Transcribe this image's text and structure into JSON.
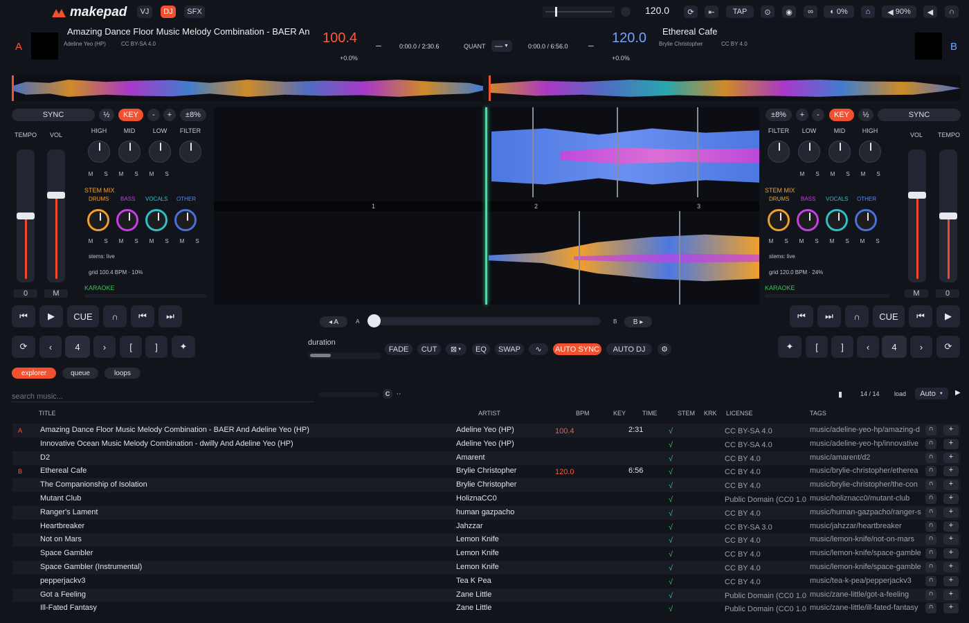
{
  "app": {
    "logo": "makepad",
    "modes": [
      "VJ",
      "DJ",
      "SFX"
    ],
    "active_mode": "DJ",
    "bpm": "120.0",
    "tap": "TAP",
    "crossfade_pct": "0%",
    "volume_pct": "90%"
  },
  "deckA": {
    "letter": "A",
    "title": "Amazing Dance Floor Music Melody Combination - BAER An",
    "artist": "Adeline Yeo (HP)",
    "license": "CC BY-SA 4.0",
    "bpm": "100.4",
    "pitch": "+0.0%",
    "time": "0:00.0 / 2:30.6",
    "sync": "SYNC",
    "half": "½",
    "key": "KEY",
    "minus": "-",
    "plus": "+",
    "range": "±8%",
    "tempo": "TEMPO",
    "vol": "VOL",
    "tempo_val": "0",
    "vol_val": "M",
    "eq": [
      "HIGH",
      "MID",
      "LOW",
      "FILTER"
    ],
    "stem_mix": "STEM MIX",
    "stems": [
      "DRUMS",
      "BASS",
      "VOCALS",
      "OTHER"
    ],
    "stems_status": "stems: live",
    "grid": "grid 100.4 BPM · 10%",
    "karaoke": "KARAOKE",
    "cue": "CUE",
    "loop_len": "4"
  },
  "deckB": {
    "letter": "B",
    "title": "Ethereal Cafe",
    "artist": "Brylie Christopher",
    "license": "CC BY 4.0",
    "bpm": "120.0",
    "pitch": "+0.0%",
    "time": "0:00.0 / 6:56.0",
    "sync": "SYNC",
    "half": "½",
    "key": "KEY",
    "minus": "-",
    "plus": "+",
    "range": "±8%",
    "tempo": "TEMPO",
    "vol": "VOL",
    "tempo_val": "0",
    "vol_val": "M",
    "eq": [
      "FILTER",
      "LOW",
      "MID",
      "HIGH"
    ],
    "stem_mix": "STEM MIX",
    "stems": [
      "DRUMS",
      "BASS",
      "VOCALS",
      "OTHER"
    ],
    "stems_status": "stems: live",
    "grid": "grid 120.0 BPM · 24%",
    "karaoke": "KARAOKE",
    "cue": "CUE",
    "loop_len": "4"
  },
  "center": {
    "quant": "QUANT",
    "quant_val": "—",
    "beats": [
      "1",
      "2",
      "3"
    ],
    "xfade_a": "◂ A",
    "xfade_a_lbl": "A",
    "xfade_b": "B ▸",
    "xfade_b_lbl": "B",
    "duration": "duration",
    "fx": [
      "FADE",
      "CUT",
      "EQ",
      "SWAP",
      "AUTO SYNC",
      "AUTO DJ"
    ]
  },
  "library": {
    "tabs": [
      "explorer",
      "queue",
      "loops"
    ],
    "active_tab": "explorer",
    "search_placeholder": "search music...",
    "count": "14 / 14",
    "load": "load",
    "mode": "Auto",
    "columns": [
      "TITLE",
      "ARTIST",
      "BPM",
      "KEY",
      "TIME",
      "STEM",
      "KRK",
      "LICENSE",
      "TAGS"
    ],
    "rows": [
      {
        "deck": "A",
        "title": "Amazing Dance Floor Music Melody Combination - BAER And Adeline Yeo (HP)",
        "artist": "Adeline Yeo (HP)",
        "bpm": "100.4",
        "time": "2:31",
        "stem": "√",
        "license": "CC BY-SA 4.0",
        "tags": "music/adeline-yeo-hp/amazing-d"
      },
      {
        "deck": "",
        "title": "Innovative Ocean Music Melody Combination - dwilly And Adeline Yeo (HP)",
        "artist": "Adeline Yeo (HP)",
        "bpm": "",
        "time": "",
        "stem": "√",
        "license": "CC BY-SA 4.0",
        "tags": "music/adeline-yeo-hp/innovative"
      },
      {
        "deck": "",
        "title": "D2",
        "artist": "Amarent",
        "bpm": "",
        "time": "",
        "stem": "√",
        "license": "CC BY 4.0",
        "tags": "music/amarent/d2"
      },
      {
        "deck": "B",
        "title": "Ethereal Cafe",
        "artist": "Brylie Christopher",
        "bpm": "120.0",
        "time": "6:56",
        "stem": "√",
        "license": "CC BY 4.0",
        "tags": "music/brylie-christopher/etherea"
      },
      {
        "deck": "",
        "title": "The Companionship of Isolation",
        "artist": "Brylie Christopher",
        "bpm": "",
        "time": "",
        "stem": "√",
        "license": "CC BY 4.0",
        "tags": "music/brylie-christopher/the-con"
      },
      {
        "deck": "",
        "title": "Mutant Club",
        "artist": "HoliznaCC0",
        "bpm": "",
        "time": "",
        "stem": "√",
        "license": "Public Domain (CC0 1.0",
        "tags": "music/holiznacc0/mutant-club"
      },
      {
        "deck": "",
        "title": "Ranger's Lament",
        "artist": "human gazpacho",
        "bpm": "",
        "time": "",
        "stem": "√",
        "license": "CC BY 4.0",
        "tags": "music/human-gazpacho/ranger-s"
      },
      {
        "deck": "",
        "title": "Heartbreaker",
        "artist": "Jahzzar",
        "bpm": "",
        "time": "",
        "stem": "√",
        "license": "CC BY-SA 3.0",
        "tags": "music/jahzzar/heartbreaker"
      },
      {
        "deck": "",
        "title": "Not on Mars",
        "artist": "Lemon Knife",
        "bpm": "",
        "time": "",
        "stem": "√",
        "license": "CC BY 4.0",
        "tags": "music/lemon-knife/not-on-mars"
      },
      {
        "deck": "",
        "title": "Space Gambler",
        "artist": "Lemon Knife",
        "bpm": "",
        "time": "",
        "stem": "√",
        "license": "CC BY 4.0",
        "tags": "music/lemon-knife/space-gamble"
      },
      {
        "deck": "",
        "title": "Space Gambler (Instrumental)",
        "artist": "Lemon Knife",
        "bpm": "",
        "time": "",
        "stem": "√",
        "license": "CC BY 4.0",
        "tags": "music/lemon-knife/space-gamble"
      },
      {
        "deck": "",
        "title": "pepperjackv3",
        "artist": "Tea K Pea",
        "bpm": "",
        "time": "",
        "stem": "√",
        "license": "CC BY 4.0",
        "tags": "music/tea-k-pea/pepperjackv3"
      },
      {
        "deck": "",
        "title": "Got a Feeling",
        "artist": "Zane Little",
        "bpm": "",
        "time": "",
        "stem": "√",
        "license": "Public Domain (CC0 1.0",
        "tags": "music/zane-little/got-a-feeling"
      },
      {
        "deck": "",
        "title": "Ill-Fated Fantasy",
        "artist": "Zane Little",
        "bpm": "",
        "time": "",
        "stem": "√",
        "license": "Public Domain (CC0 1.0",
        "tags": "music/zane-little/ill-fated-fantasy"
      }
    ]
  },
  "colors": {
    "accent": "#f2502e",
    "deckA": "#ff5a3a",
    "deckB": "#6ea4ff",
    "stem_drums": "#f0a02a",
    "stem_bass": "#c440e6",
    "stem_vocals": "#2ec0c8",
    "stem_other": "#4872d8",
    "karaoke": "#3ec25a",
    "check": "#3ec25a"
  }
}
